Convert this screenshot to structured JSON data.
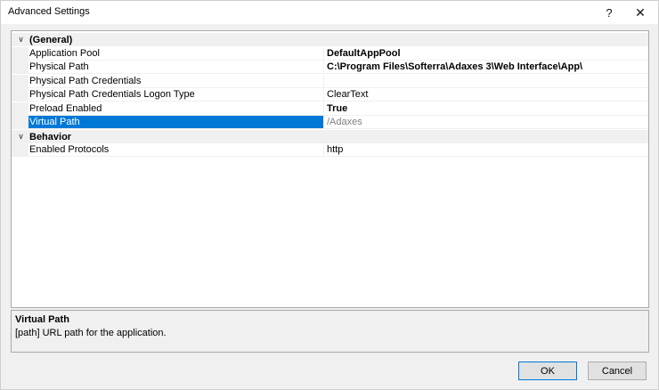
{
  "window": {
    "title": "Advanced Settings",
    "help_glyph": "?",
    "close_glyph": "✕"
  },
  "grid": {
    "categories": [
      {
        "label": "(General)",
        "expander": "∨",
        "properties": [
          {
            "name": "Application Pool",
            "value": "DefaultAppPool",
            "bold": true
          },
          {
            "name": "Physical Path",
            "value": "C:\\Program Files\\Softerra\\Adaxes 3\\Web Interface\\App\\",
            "bold": true
          },
          {
            "name": "Physical Path Credentials",
            "value": ""
          },
          {
            "name": "Physical Path Credentials Logon Type",
            "value": "ClearText"
          },
          {
            "name": "Preload Enabled",
            "value": "True",
            "bold": true
          },
          {
            "name": "Virtual Path",
            "value": "/Adaxes",
            "selected": true,
            "readonly": true
          }
        ]
      },
      {
        "label": "Behavior",
        "expander": "∨",
        "properties": [
          {
            "name": "Enabled Protocols",
            "value": "http"
          }
        ]
      }
    ]
  },
  "description": {
    "title": "Virtual Path",
    "text": "[path] URL path for the application."
  },
  "buttons": {
    "ok_label": "OK",
    "cancel_label": "Cancel"
  },
  "colors": {
    "selection": "#0078d7",
    "category_background": "#f0f0f0",
    "readonly_text": "#808080"
  }
}
